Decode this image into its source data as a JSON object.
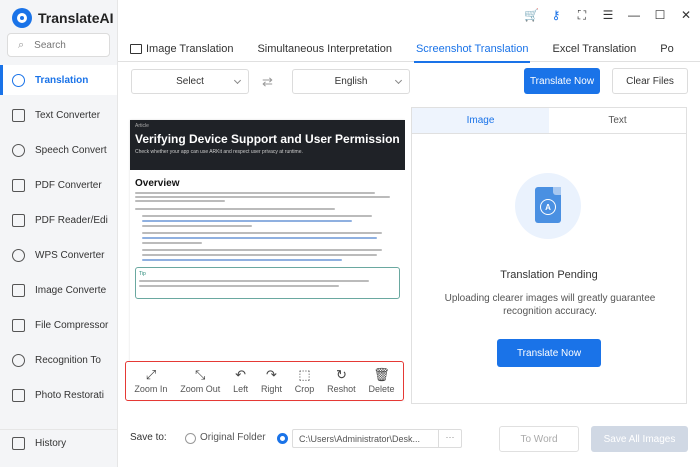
{
  "app": {
    "name": "TranslateAI"
  },
  "search": {
    "placeholder": "Search"
  },
  "sidebar": {
    "items": [
      {
        "label": "Translation",
        "active": true
      },
      {
        "label": "Text Converter"
      },
      {
        "label": "Speech Convert"
      },
      {
        "label": "PDF Converter"
      },
      {
        "label": "PDF Reader/Edi"
      },
      {
        "label": "WPS Converter"
      },
      {
        "label": "Image Converte"
      },
      {
        "label": "File Compressor"
      },
      {
        "label": "Recognition To"
      },
      {
        "label": "Photo Restorati"
      }
    ],
    "history_label": "History"
  },
  "tabs": [
    {
      "label": "Image Translation"
    },
    {
      "label": "Simultaneous Interpretation"
    },
    {
      "label": "Screenshot Translation",
      "active": true
    },
    {
      "label": "Excel Translation"
    },
    {
      "label": "Po"
    }
  ],
  "toolbar": {
    "source_language": "Select",
    "target_language": "English",
    "swap_icon": "⇄",
    "translate_now": "Translate Now",
    "clear_files": "Clear Files"
  },
  "document": {
    "kicker": "Article",
    "title": "Verifying Device Support and User Permission",
    "subtitle": "Check whether your app can use ARKit and respect user privacy at runtime.",
    "heading": "Overview",
    "tip_label": "Tip"
  },
  "image_tools": [
    {
      "label": "Zoom In",
      "glyph": "⤢"
    },
    {
      "label": "Zoom Out",
      "glyph": "⤡"
    },
    {
      "label": "Left",
      "glyph": "↶"
    },
    {
      "label": "Right",
      "glyph": "↷"
    },
    {
      "label": "Crop",
      "glyph": "⬚"
    },
    {
      "label": "Reshot",
      "glyph": "↻"
    },
    {
      "label": "Delete",
      "glyph": "🗑"
    }
  ],
  "result_panel": {
    "tabs": [
      {
        "label": "Image",
        "active": true
      },
      {
        "label": "Text"
      }
    ],
    "status_title": "Translation Pending",
    "status_desc": "Uploading clearer images will greatly guarantee recognition accuracy.",
    "translate_button": "Translate Now"
  },
  "bottom": {
    "save_to_label": "Save to:",
    "original_folder": "Original Folder",
    "path": "C:\\Users\\Administrator\\Desk...",
    "path_more": "···",
    "to_word": "To Word",
    "save_all_images": "Save All Images"
  },
  "colors": {
    "accent": "#1a73e8",
    "tool_border": "#e53935",
    "disabled_button": "#d0d8e4"
  }
}
